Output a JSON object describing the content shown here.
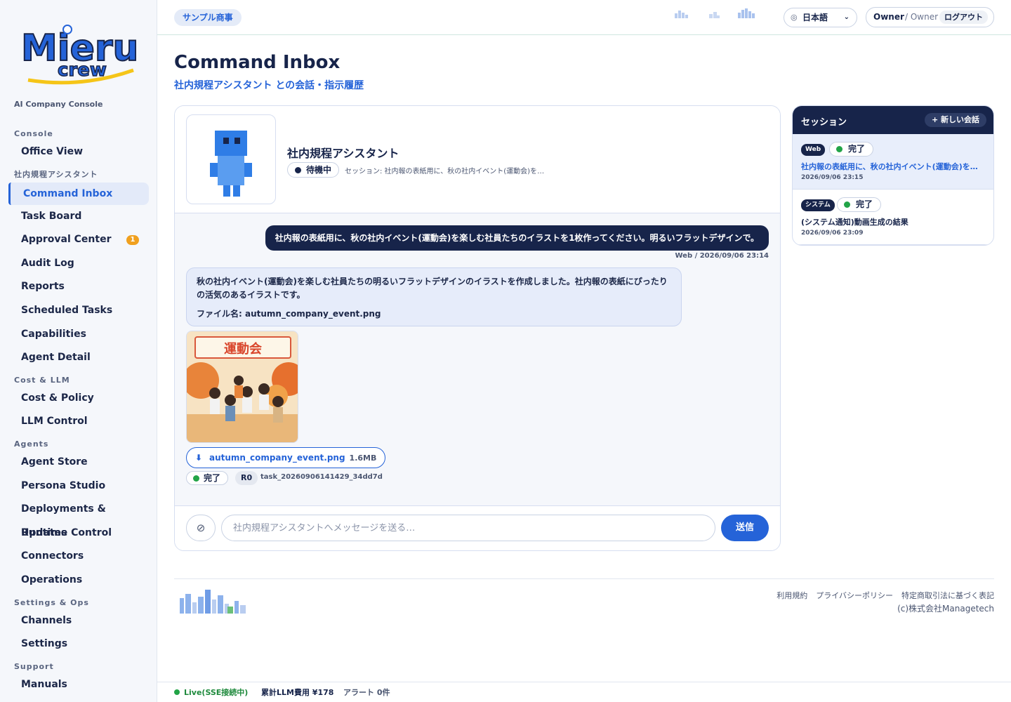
{
  "brand": {
    "console_label": "AI Company Console",
    "sample_label": "サンプル商事"
  },
  "nav": {
    "sections": [
      {
        "label": "Console",
        "items": [
          {
            "label": "Office View"
          }
        ]
      },
      {
        "label": "社内規程アシスタント",
        "items": [
          {
            "label": "Command Inbox",
            "active": true
          },
          {
            "label": "Task Board"
          },
          {
            "label": "Approval Center",
            "badge": "1"
          },
          {
            "label": "Audit Log"
          },
          {
            "label": "Reports"
          },
          {
            "label": "Scheduled Tasks"
          },
          {
            "label": "Capabilities"
          },
          {
            "label": "Agent Detail"
          }
        ]
      },
      {
        "label": "Cost & LLM",
        "items": [
          {
            "label": "Cost & Policy"
          },
          {
            "label": "LLM Control"
          }
        ]
      },
      {
        "label": "Agents",
        "items": [
          {
            "label": "Agent Store"
          },
          {
            "label": "Persona Studio"
          },
          {
            "label": "Deployments & Updates"
          },
          {
            "label": "Runtime Control"
          },
          {
            "label": "Connectors"
          },
          {
            "label": "Operations"
          }
        ]
      },
      {
        "label": "Settings & Ops",
        "items": [
          {
            "label": "Channels"
          },
          {
            "label": "Settings"
          }
        ]
      },
      {
        "label": "Support",
        "items": [
          {
            "label": "Manuals"
          }
        ]
      }
    ]
  },
  "topbar": {
    "language": "日本語",
    "user_name": "Owner",
    "user_role": "/ Owner",
    "logout_label": "ログアウト"
  },
  "page": {
    "title": "Command Inbox",
    "subtitle": "社内規程アシスタント との会話・指示履歴"
  },
  "agent": {
    "name": "社内規程アシスタント",
    "status": "待機中",
    "session_line": "セッション: 社内報の表紙用に、秋の社内イベント(運動会)を楽…"
  },
  "messages": {
    "user_text": "社内報の表紙用に、秋の社内イベント(運動会)を楽しむ社員たちのイラストを1枚作ってください。明るいフラットデザインで。",
    "user_meta": "Web / 2026/09/06 23:14",
    "bot_text": "秋の社内イベント(運動会)を楽しむ社員たちの明るいフラットデザインのイラストを作成しました。社内報の表紙にぴったりの活気のあるイラストです。",
    "bot_file_line": "ファイル名: autumn_company_event.png",
    "image_banner": "運動会",
    "file_name": "autumn_company_event.png",
    "file_size": "1.6MB",
    "status": "完了",
    "retry": "R0",
    "task_id": "task_20260906141429_34dd7d"
  },
  "composer": {
    "placeholder": "社内規程アシスタントへメッセージを送る…",
    "send_label": "送信"
  },
  "sessions": {
    "title": "セッション",
    "new_label": "+ 新しい会話",
    "items": [
      {
        "tag": "Web",
        "status": "完了",
        "title": "社内報の表紙用に、秋の社内イベント(運動会)を楽…",
        "time": "2026/09/06 23:15"
      },
      {
        "tag": "システム",
        "status": "完了",
        "title": "(システム通知)動画生成の結果",
        "time": "2026/09/06 23:09"
      }
    ]
  },
  "footer": {
    "terms": "利用規約",
    "privacy": "プライバシーポリシー",
    "commerce": "特定商取引法に基づく表記",
    "copyright": "(c)株式会社Managetech"
  },
  "statusbar": {
    "live": "Live(SSE接続中)",
    "cost": "累計LLM費用 ¥178",
    "alerts": "アラート 0件"
  },
  "colors": {
    "navy": "#17244a",
    "accent": "#2563d8",
    "success": "#22a447",
    "badge": "#f0a01e"
  }
}
